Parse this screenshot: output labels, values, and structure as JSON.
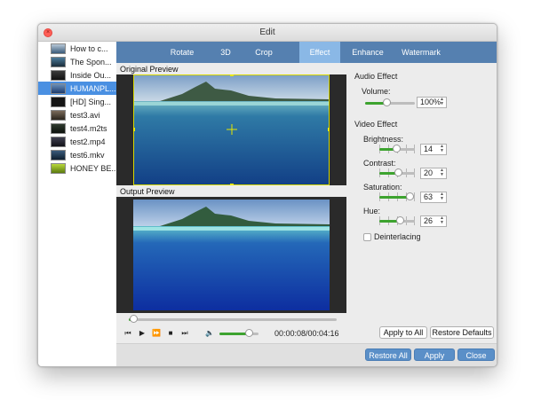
{
  "window": {
    "title": "Edit"
  },
  "files": [
    {
      "name": "How to c...",
      "selected": false
    },
    {
      "name": "The Spon...",
      "selected": false
    },
    {
      "name": "Inside Ou...",
      "selected": false
    },
    {
      "name": "HUMANPL...",
      "selected": true
    },
    {
      "name": "[HD] Sing...",
      "selected": false
    },
    {
      "name": "test3.avi",
      "selected": false
    },
    {
      "name": "test4.m2ts",
      "selected": false
    },
    {
      "name": "test2.mp4",
      "selected": false
    },
    {
      "name": "test6.mkv",
      "selected": false
    },
    {
      "name": "HONEY BE...",
      "selected": false
    }
  ],
  "tabs": [
    {
      "label": "Rotate",
      "active": false
    },
    {
      "label": "3D",
      "active": false
    },
    {
      "label": "Crop",
      "active": false
    },
    {
      "label": "Effect",
      "active": true
    },
    {
      "label": "Enhance",
      "active": false
    },
    {
      "label": "Watermark",
      "active": false
    }
  ],
  "preview": {
    "original_label": "Original Preview",
    "output_label": "Output Preview"
  },
  "player": {
    "timecode": "00:00:08/00:04:16",
    "progress": 0.02,
    "volume": 0.75,
    "controls": [
      "prev",
      "play",
      "fast-forward",
      "stop",
      "next"
    ]
  },
  "audio": {
    "section_title": "Audio Effect",
    "volume_label": "Volume:",
    "volume_value": "100%"
  },
  "video": {
    "section_title": "Video Effect",
    "brightness_label": "Brightness:",
    "brightness_value": "14",
    "contrast_label": "Contrast:",
    "contrast_value": "20",
    "saturation_label": "Saturation:",
    "saturation_value": "63",
    "hue_label": "Hue:",
    "hue_value": "26",
    "deinterlacing_label": "Deinterlacing",
    "deinterlacing_checked": false
  },
  "buttons": {
    "apply_to_all": "Apply to All",
    "restore_defaults": "Restore Defaults",
    "restore_all": "Restore All",
    "apply": "Apply",
    "close": "Close"
  },
  "colors": {
    "tab_bar": "#5580b0",
    "tab_active": "#8ab8e6",
    "selection": "#4a90e2",
    "slider_fill": "#3da32f",
    "blue_button": "#5a8fc8"
  }
}
